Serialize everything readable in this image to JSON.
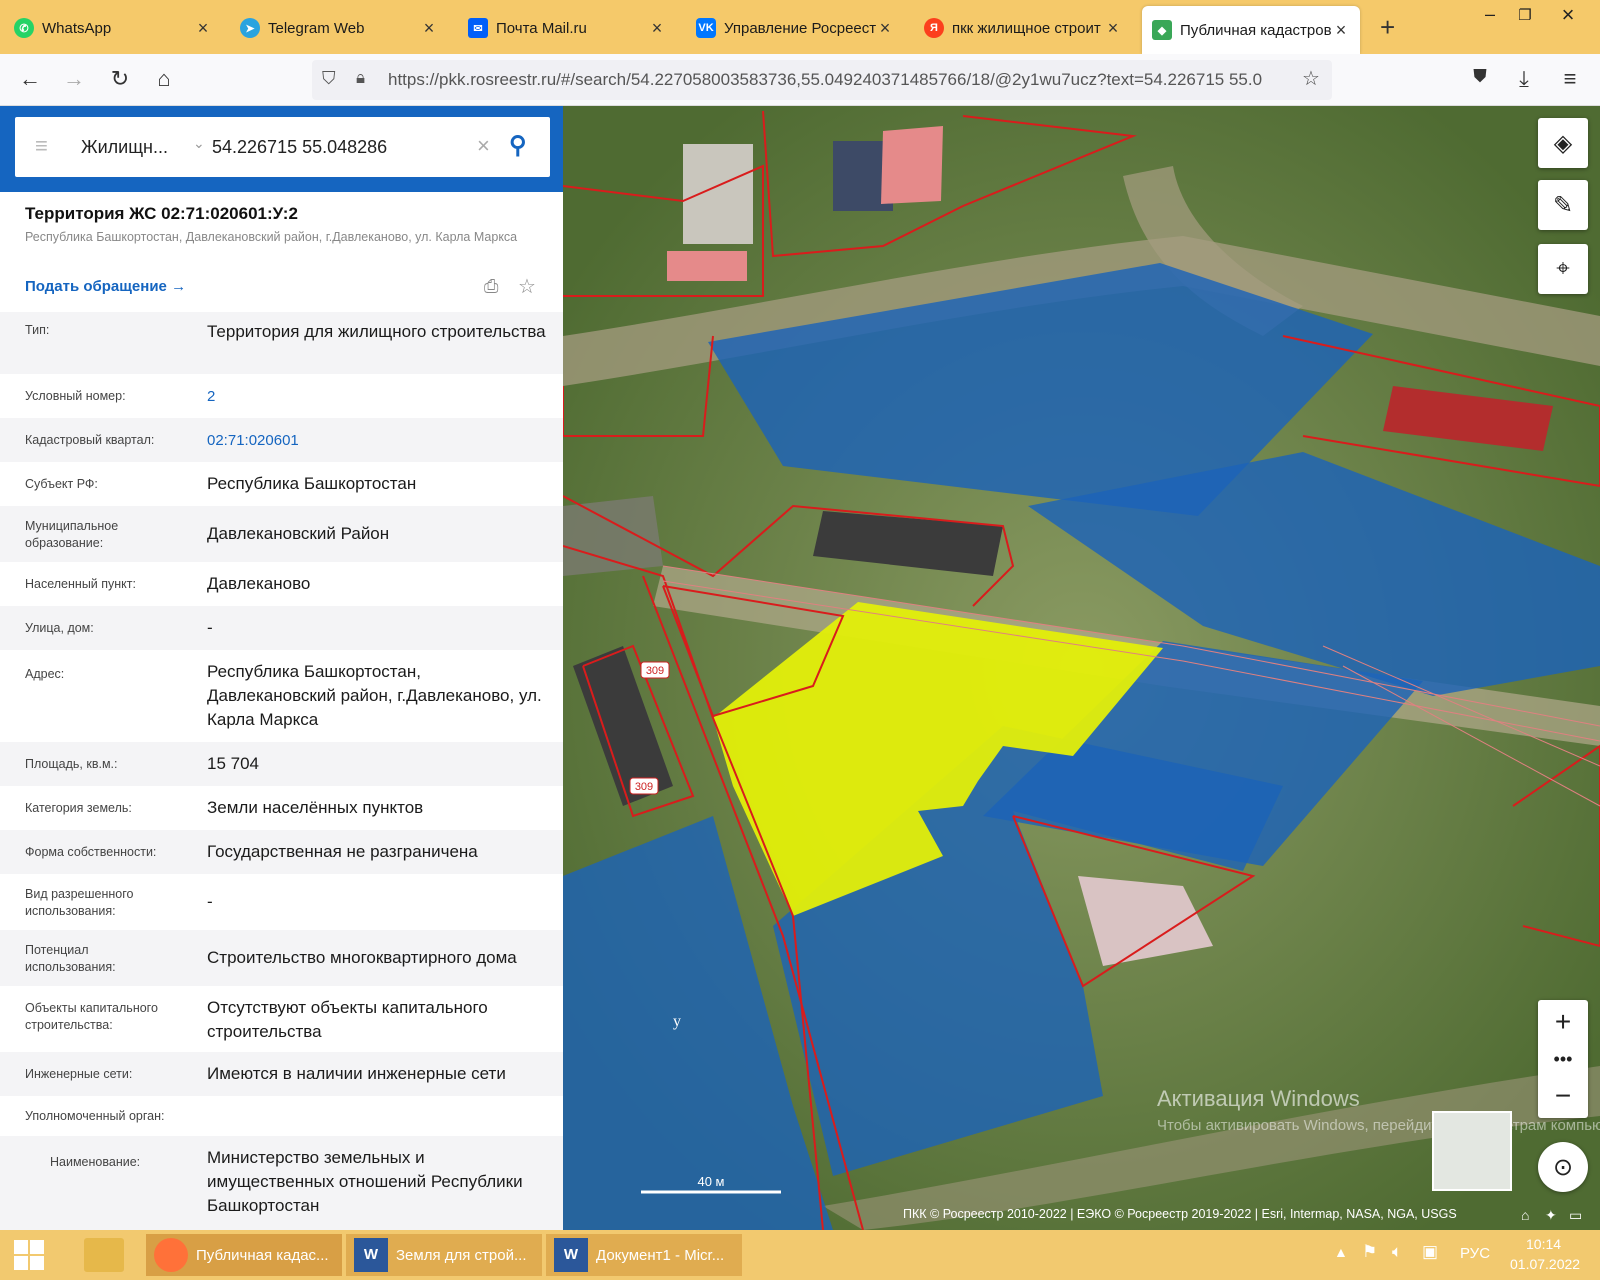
{
  "browser": {
    "tabs": [
      {
        "title": "WhatsApp",
        "icon": "whatsapp-icon",
        "color": "#25d366"
      },
      {
        "title": "Telegram Web",
        "icon": "telegram-icon",
        "color": "#2aa3df"
      },
      {
        "title": "Почта Mail.ru",
        "icon": "mail-icon",
        "color": "#005ff9"
      },
      {
        "title": "Управление Росреестр",
        "icon": "vk-icon",
        "color": "#0077ff"
      },
      {
        "title": "пкк жилищное строит",
        "icon": "yandex-icon",
        "color": "#fc3f1d"
      },
      {
        "title": "Публичная кадастров",
        "icon": "rosreestr-icon",
        "color": "#3aa757"
      }
    ],
    "url": "https://pkk.rosreestr.ru/#/search/54.227058003583736,55.049240371485766/18/@2y1wu7ucz?text=54.226715 55.0"
  },
  "search": {
    "layer": "Жилищн...",
    "query": "54.226715 55.048286"
  },
  "object": {
    "title": "Территория ЖС 02:71:020601:У:2",
    "address_sub": "Республика Башкортостан, Давлекановский район, г.Давлеканово, ул. Карла Маркса",
    "appeal_link": "Подать обращение",
    "fields": [
      {
        "label": "Тип:",
        "value": "Территория для жилищного строительства"
      },
      {
        "label": "Условный номер:",
        "value": "2"
      },
      {
        "label": "Кадастровый квартал:",
        "value": "02:71:020601"
      },
      {
        "label": "Субъект РФ:",
        "value": "Республика Башкортостан"
      },
      {
        "label": "Муниципальное образование:",
        "value": "Давлекановский Район"
      },
      {
        "label": "Населенный пункт:",
        "value": "Давлеканово"
      },
      {
        "label": "Улица, дом:",
        "value": "-"
      },
      {
        "label": "Адрес:",
        "value": "Республика Башкортостан, Давлекановский район, г.Давлеканово, ул. Карла Маркса"
      },
      {
        "label": "Площадь, кв.м.:",
        "value": "15 704"
      },
      {
        "label": "Категория земель:",
        "value": "Земли населённых пунктов"
      },
      {
        "label": "Форма собственности:",
        "value": "Государственная не разграничена"
      },
      {
        "label": "Вид разрешенного использования:",
        "value": "-"
      },
      {
        "label": "Потенциал использования:",
        "value": "Строительство многоквартирного дома"
      },
      {
        "label": "Объекты капитального строительства:",
        "value": "Отсутствуют объекты капитального строительства"
      },
      {
        "label": "Инженерные сети:",
        "value": "Имеются в наличии инженерные сети"
      },
      {
        "label": "Уполномоченный орган:",
        "value": ""
      },
      {
        "label": "Наименование:",
        "value": "Министерство земельных и имущественных отношений Республики Башкортостан"
      }
    ]
  },
  "map": {
    "labels": [
      "309",
      "309",
      "y"
    ],
    "scale": "40 м",
    "attribution": "ПКК © Росреестр 2010-2022 | ЕЭКО © Росреестр 2019-2022 | Esri, Intermap, NASA, NGA, USGS",
    "watermark_title": "Активация Windows",
    "watermark_text": "Чтобы активировать Windows, перейдите к параметрам компьютера."
  },
  "taskbar": {
    "items": [
      {
        "label": "Публичная кадас...",
        "icon": "firefox-icon"
      },
      {
        "label": "Земля для строй...",
        "icon": "word-icon"
      },
      {
        "label": "Документ1 - Micr...",
        "icon": "word-icon"
      }
    ],
    "lang": "РУС",
    "time": "10:14",
    "date": "01.07.2022"
  }
}
